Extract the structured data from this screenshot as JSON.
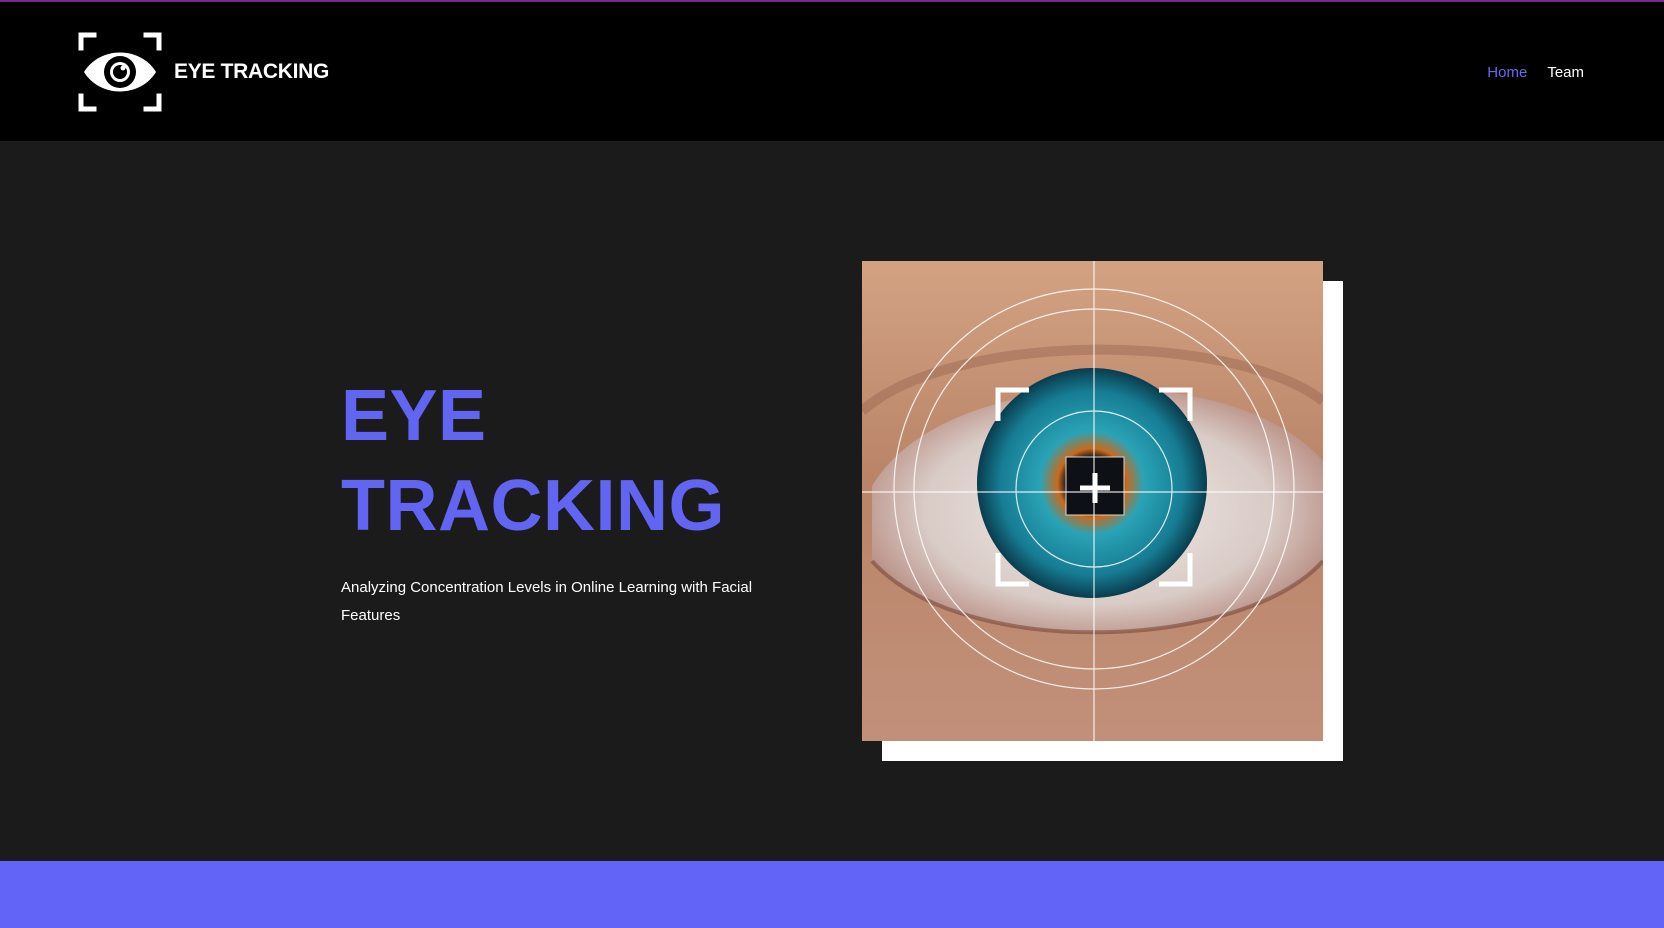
{
  "brand": {
    "name": "EYE TRACKING",
    "logo_icon": "eye-scan-icon"
  },
  "nav": {
    "items": [
      {
        "label": "Home",
        "active": true
      },
      {
        "label": "Team",
        "active": false
      }
    ]
  },
  "hero": {
    "title_line1": "EYE",
    "title_line2": "TRACKING",
    "subtitle": "Analyzing Concentration Levels in Online Learning with Facial Features",
    "image": "eye-closeup-with-targeting-reticle"
  },
  "colors": {
    "accent": "#6264f2",
    "header_bg": "#000000",
    "page_bg": "#1b1b1c",
    "footer_bg": "#6264f7"
  }
}
